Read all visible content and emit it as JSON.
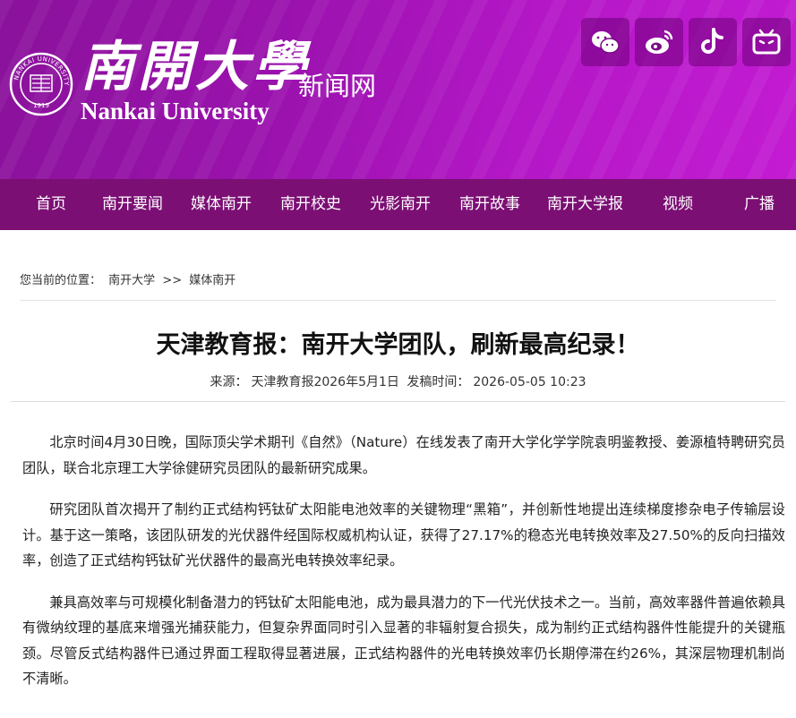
{
  "header": {
    "logo_cn": "南開大學",
    "logo_en": "Nankai University",
    "site_name": "新闻网",
    "seal_text": "NANKAI UNIVERSITY",
    "seal_year": "1919",
    "social_icons": [
      "wechat-icon",
      "weibo-icon",
      "tiktok-icon",
      "bilibili-icon"
    ]
  },
  "nav": {
    "items": [
      "首页",
      "南开要闻",
      "媒体南开",
      "南开校史",
      "光影南开",
      "南开故事",
      "南开大学报",
      "视频",
      "广播"
    ]
  },
  "breadcrumb": {
    "prefix": "您当前的位置：",
    "items": [
      "南开大学",
      ">>",
      "媒体南开"
    ]
  },
  "article": {
    "title": "天津教育报：南开大学团队，刷新最高纪录！",
    "source_label": "来源：",
    "source": "天津教育报2026年5月1日",
    "time_label": "发稿时间：",
    "time": "2026-05-05 10:23",
    "paragraphs": [
      "北京时间4月30日晚，国际顶尖学术期刊《自然》（Nature）在线发表了南开大学化学学院袁明鉴教授、姜源植特聘研究员团队，联合北京理工大学徐健研究员团队的最新研究成果。",
      "研究团队首次揭开了制约正式结构钙钛矿太阳能电池效率的关键物理“黑箱”，并创新性地提出连续梯度掺杂电子传输层设计。基于这一策略，该团队研发的光伏器件经国际权威机构认证，获得了27.17%的稳态光电转换效率及27.50%的反向扫描效率，创造了正式结构钙钛矿光伏器件的最高光电转换效率纪录。",
      "兼具高效率与可规模化制备潜力的钙钛矿太阳能电池，成为最具潜力的下一代光伏技术之一。当前，高效率器件普遍依赖具有微纳纹理的基底来增强光捕获能力，但复杂界面同时引入显著的非辐射复合损失，成为制约正式结构器件性能提升的关键瓶颈。尽管反式结构器件已通过界面工程取得显著进展，正式结构器件的光电转换效率仍长期停滞在约26%，其深层物理机制尚不清晰。"
    ]
  },
  "colors": {
    "header_start": "#8a129b",
    "header_end": "#c31bd3",
    "nav_bg": "#7b0f74",
    "social_bg": "#6e0078"
  }
}
